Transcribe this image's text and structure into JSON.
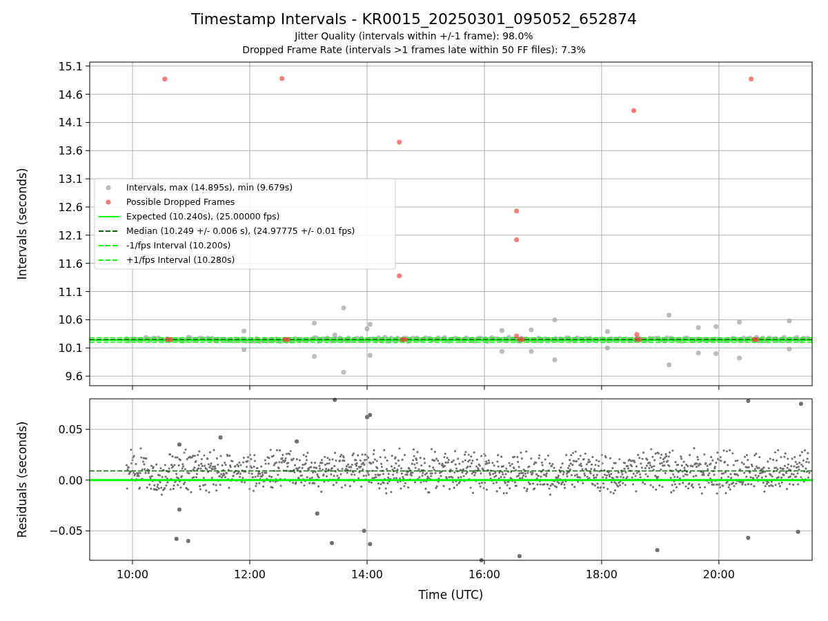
{
  "title": "Timestamp Intervals - KR0015_20250301_095052_652874",
  "subtitles": [
    "Jitter Quality (intervals within +/-1 frame): 98.0%",
    "Dropped Frame Rate (intervals >1 frames late within 50 FF files): 7.3%"
  ],
  "charts": [
    {
      "chart_data": {
        "type": "scatter",
        "ylabel": "Intervals (seconds)",
        "grid": true,
        "legend": "center left",
        "xlim": [
          9.27,
          21.59
        ],
        "ylim": [
          9.43,
          15.17
        ],
        "yticks": [
          {
            "value": 9.6,
            "label": "9.6"
          },
          {
            "value": 10.1,
            "label": "10.1"
          },
          {
            "value": 10.6,
            "label": "10.6"
          },
          {
            "value": 11.1,
            "label": "11.1"
          },
          {
            "value": 11.6,
            "label": "11.6"
          },
          {
            "value": 12.1,
            "label": "12.1"
          },
          {
            "value": 12.6,
            "label": "12.6"
          },
          {
            "value": 13.1,
            "label": "13.1"
          },
          {
            "value": 13.6,
            "label": "13.6"
          },
          {
            "value": 14.1,
            "label": "14.1"
          },
          {
            "value": 14.6,
            "label": "14.6"
          },
          {
            "value": 15.1,
            "label": "15.1"
          }
        ],
        "series": [
          {
            "name": "Intervals, max (14.895s), min (9.679s)",
            "color": "#a0a0a0",
            "x": [
              13.6,
              13.6,
              14.05,
              13.1,
              13.1,
              11.9,
              11.9,
              14.05,
              16.3,
              16.3,
              17.2,
              17.2,
              16.8,
              16.8,
              18.1,
              18.1,
              19.15,
              19.15,
              19.65,
              19.65,
              20.35,
              20.35,
              21.2,
              21.2,
              14.0,
              13.45,
              19.95,
              19.95
            ],
            "values": [
              10.81,
              9.67,
              10.52,
              9.95,
              10.54,
              10.4,
              10.07,
              9.97,
              10.41,
              10.04,
              10.6,
              9.89,
              10.42,
              10.04,
              10.39,
              10.1,
              10.68,
              9.8,
              10.46,
              10.01,
              10.56,
              9.92,
              10.58,
              10.08,
              10.44,
              10.33,
              10.48,
              10.0
            ]
          },
          {
            "name": "Possible Dropped Frames",
            "color": "#ff4040",
            "x": [
              10.55,
              12.55,
              14.55,
              14.55,
              16.55,
              16.55,
              18.55,
              20.55,
              10.6,
              10.65,
              12.6,
              12.65,
              14.6,
              14.65,
              16.6,
              16.65,
              18.6,
              18.65,
              20.6,
              20.65,
              16.55,
              18.6
            ],
            "values": [
              14.87,
              14.88,
              13.75,
              11.38,
              12.53,
              12.02,
              14.31,
              14.87,
              10.25,
              10.25,
              10.25,
              10.25,
              10.25,
              10.25,
              10.25,
              10.25,
              10.25,
              10.25,
              10.25,
              10.25,
              10.31,
              10.34
            ]
          }
        ],
        "ref_lines": [
          {
            "axis": "y",
            "label": "Expected (10.240s), (25.00000 fps)",
            "value": 10.24,
            "color": "#00ff00"
          },
          {
            "axis": "y",
            "label": "Median (10.249 +/- 0.006 s), (24.97775 +/- 0.01 fps)",
            "value": 10.249,
            "color": "#006400"
          },
          {
            "axis": "y",
            "label": "-1/fps Interval (10.200s)",
            "value": 10.2,
            "color": "#00ff00"
          },
          {
            "axis": "y",
            "label": "+1/fps Interval (10.280s)",
            "value": 10.28,
            "color": "#00ff00"
          }
        ]
      }
    },
    {
      "chart_data": {
        "type": "scatter",
        "xlabel": "Time (UTC)",
        "ylabel": "Residuals (seconds)",
        "grid": true,
        "xlim": [
          9.27,
          21.59
        ],
        "ylim": [
          -0.079,
          0.08
        ],
        "xticks": [
          {
            "value": 10,
            "label": "10:00"
          },
          {
            "value": 12,
            "label": "12:00"
          },
          {
            "value": 14,
            "label": "14:00"
          },
          {
            "value": 16,
            "label": "16:00"
          },
          {
            "value": 18,
            "label": "18:00"
          },
          {
            "value": 20,
            "label": "20:00"
          }
        ],
        "yticks": [
          {
            "value": -0.05,
            "label": "−0.05"
          },
          {
            "value": 0,
            "label": "0.00"
          },
          {
            "value": 0.05,
            "label": "0.05"
          }
        ],
        "series": [
          {
            "color": "#707070",
            "x": [
              10.8,
              11.5,
              12.8,
              14.0,
              14.05,
              10.8,
              10.75,
              10.95,
              13.15,
              13.4,
              13.95,
              14.05,
              15.95,
              16.6,
              18.95,
              20.5,
              21.35,
              20.5,
              21.4,
              13.45
            ],
            "values": [
              0.035,
              0.042,
              0.038,
              0.062,
              0.064,
              -0.029,
              -0.058,
              -0.06,
              -0.033,
              -0.062,
              -0.05,
              -0.063,
              -0.079,
              -0.075,
              -0.069,
              -0.057,
              -0.051,
              0.078,
              0.075,
              0.079
            ]
          }
        ],
        "ref_lines": [
          {
            "axis": "y",
            "value": 0,
            "color": "#00ff00"
          },
          {
            "axis": "y",
            "value": 0.009,
            "color": "#006400"
          }
        ]
      }
    }
  ]
}
